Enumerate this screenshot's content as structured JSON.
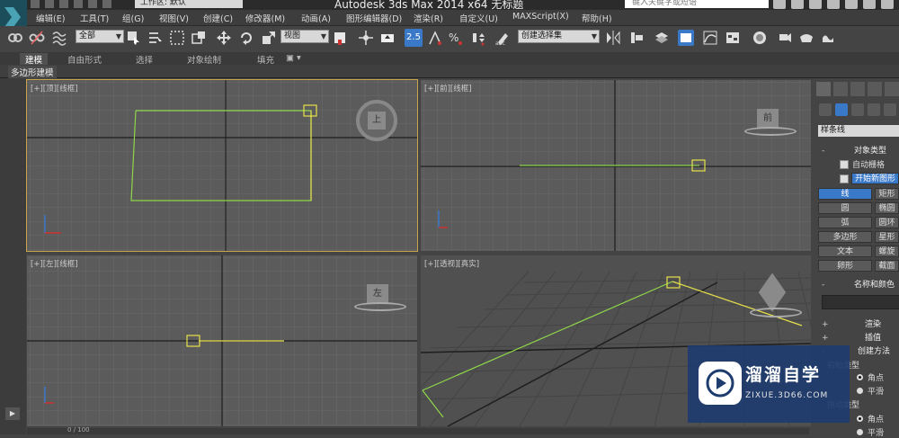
{
  "titlebar": {
    "workspace_label": "工作区: 默认",
    "app_title": "Autodesk 3ds Max  2014 x64      无标题",
    "search_placeholder": "键入关键字或短语"
  },
  "menu": [
    "编辑(E)",
    "工具(T)",
    "组(G)",
    "视图(V)",
    "创建(C)",
    "修改器(M)",
    "动画(A)",
    "图形编辑器(D)",
    "渲染(R)",
    "自定义(U)",
    "MAXScript(X)",
    "帮助(H)"
  ],
  "toolbar": {
    "selection_filter": "全部",
    "reference_coord": "视图",
    "snap_value": "2.5",
    "named_selection": "创建选择集"
  },
  "ribbon": {
    "tabs": [
      "建模",
      "自由形式",
      "选择",
      "对象绘制",
      "填充"
    ],
    "active_tab": "建模",
    "panel_label": "多边形建模"
  },
  "viewports": {
    "top": {
      "label": "[+][顶][线框]",
      "cube_face": "上"
    },
    "front": {
      "label": "[+][前][线框]",
      "cube_face": "前"
    },
    "left": {
      "label": "[+][左][线框]",
      "cube_face": "左"
    },
    "perspective": {
      "label": "[+][透视][真实]"
    }
  },
  "status": {
    "frame": "0 / 100"
  },
  "command_panel": {
    "category_dropdown": "样条线",
    "object_type_header": "对象类型",
    "auto_grid_label": "自动栅格",
    "start_new_shape_label": "开始新图形",
    "shape_buttons": [
      [
        "线",
        "矩形"
      ],
      [
        "圆",
        "椭圆"
      ],
      [
        "弧",
        "圆环"
      ],
      [
        "多边形",
        "星形"
      ],
      [
        "文本",
        "螺旋线"
      ],
      [
        "卵形",
        "截面"
      ]
    ],
    "active_shape": "线",
    "name_color_header": "名称和颜色",
    "rollouts": [
      {
        "pm": "+",
        "label": "渲染"
      },
      {
        "pm": "+",
        "label": "插值"
      },
      {
        "pm": "-",
        "label": "创建方法"
      }
    ],
    "initial_type_label": "初始类型",
    "initial_options": [
      "角点",
      "平滑"
    ],
    "drag_type_label": "拖动类型",
    "drag_options": [
      "角点",
      "平滑"
    ]
  },
  "watermark": {
    "title": "溜溜自学",
    "url": "ZIXUE.3D66.COM"
  },
  "colors": {
    "accent_blue": "#3a78c8",
    "spline_yellow": "#e6e14a",
    "spline_green": "#8fd64a",
    "viewport_active": "#c8a44a"
  }
}
